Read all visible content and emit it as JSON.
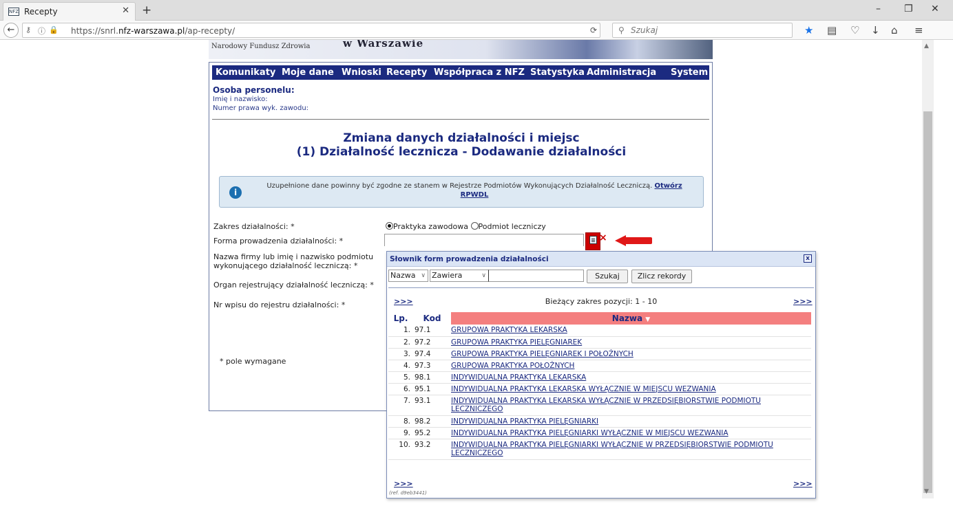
{
  "browser": {
    "tab_title": "Recepty",
    "tab_favicon": "NFZ",
    "url_prefix": "https://snrl.",
    "url_domain": "nfz-warszawa.pl",
    "url_path": "/ap-recepty/",
    "search_placeholder": "Szukaj"
  },
  "banner": {
    "org": "Narodowy Fundusz Zdrowia",
    "city": "w Warszawie"
  },
  "menu": [
    "Komunikaty",
    "Moje dane",
    "Wnioski",
    "Recepty",
    "Współpraca z NFZ",
    "Statystyka",
    "Administracja",
    "System"
  ],
  "person": {
    "heading": "Osoba personelu:",
    "name_label": "Imię i nazwisko:",
    "license_label": "Numer prawa wyk. zawodu:"
  },
  "page": {
    "title1": "Zmiana danych działalności i miejsc",
    "title2": "(1) Działalność lecznicza - Dodawanie działalności",
    "info_text": "Uzupełnione dane powinny być zgodne ze stanem w Rejestrze Podmiotów Wykonujących Działalność Leczniczą.",
    "info_link": "Otwórz RPWDL"
  },
  "form": {
    "scope_label": "Zakres działalności: *",
    "scope_options": [
      "Praktyka zawodowa",
      "Podmiot leczniczy"
    ],
    "scope_selected": "Praktyka zawodowa",
    "form_label": "Forma prowadzenia działalności: *",
    "company_label": "Nazwa firmy lub imię i nazwisko podmiotu wykonującego działalność leczniczą: *",
    "organ_label": "Organ rejestrujący działalność leczniczą: *",
    "register_label": "Nr wpisu do rejestru działalności: *",
    "required_note": "* pole wymagane"
  },
  "dialog": {
    "title": "Słownik form prowadzenia działalności",
    "field_select": "Nazwa",
    "mode_select": "Zawiera",
    "search_button": "Szukaj",
    "count_button": "Zlicz rekordy",
    "pager_label": ">>>",
    "range_text": "Bieżący zakres pozycji: 1 - 10",
    "col_lp": "Lp.",
    "col_kod": "Kod",
    "col_nazwa": "Nazwa",
    "rows": [
      {
        "lp": "1.",
        "kod": "97.1",
        "nazwa": "GRUPOWA PRAKTYKA LEKARSKA"
      },
      {
        "lp": "2.",
        "kod": "97.2",
        "nazwa": "GRUPOWA PRAKTYKA PIELĘGNIAREK"
      },
      {
        "lp": "3.",
        "kod": "97.4",
        "nazwa": "GRUPOWA PRAKTYKA PIELĘGNIAREK I POŁOŻNYCH"
      },
      {
        "lp": "4.",
        "kod": "97.3",
        "nazwa": "GRUPOWA PRAKTYKA POŁOŻNYCH"
      },
      {
        "lp": "5.",
        "kod": "98.1",
        "nazwa": "INDYWIDUALNA PRAKTYKA LEKARSKA"
      },
      {
        "lp": "6.",
        "kod": "95.1",
        "nazwa": "INDYWIDUALNA PRAKTYKA LEKARSKA WYŁĄCZNIE W MIEJSCU WEZWANIA"
      },
      {
        "lp": "7.",
        "kod": "93.1",
        "nazwa": "INDYWIDUALNA PRAKTYKA LEKARSKA WYŁĄCZNIE W PRZEDSIĘBIORSTWIE PODMIOTU LECZNICZEGO"
      },
      {
        "lp": "8.",
        "kod": "98.2",
        "nazwa": "INDYWIDUALNA PRAKTYKA PIELĘGNIARKI"
      },
      {
        "lp": "9.",
        "kod": "95.2",
        "nazwa": "INDYWIDUALNA PRAKTYKA PIELĘGNIARKI WYŁĄCZNIE W MIEJSCU WEZWANIA"
      },
      {
        "lp": "10.",
        "kod": "93.2",
        "nazwa": "INDYWIDUALNA PRAKTYKA PIELĘGNIARKI WYŁĄCZNIE W PRZEDSIĘBIORSTWIE PODMIOTU LECZNICZEGO"
      }
    ],
    "ref": "(ref. d9eb3441)"
  },
  "colors": {
    "menu_bg": "#1b2a80",
    "header_sort": "#f47f7f",
    "accent_red": "#e01818"
  }
}
